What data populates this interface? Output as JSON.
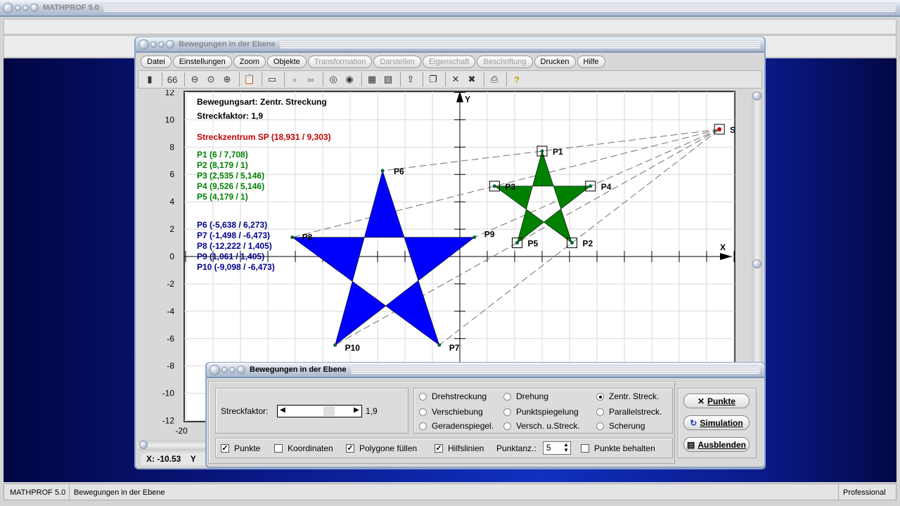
{
  "app": {
    "title": "MATHPROF 5.0"
  },
  "window": {
    "title": "Bewegungen in der Ebene",
    "menu": [
      {
        "label": "Datei",
        "enabled": true
      },
      {
        "label": "Einstellungen",
        "enabled": true
      },
      {
        "label": "Zoom",
        "enabled": true
      },
      {
        "label": "Objekte",
        "enabled": true
      },
      {
        "label": "Transformation",
        "enabled": false
      },
      {
        "label": "Darstellen",
        "enabled": false
      },
      {
        "label": "Eigenschaft",
        "enabled": false
      },
      {
        "label": "Beschriftung",
        "enabled": false
      },
      {
        "label": "Drucken",
        "enabled": true
      },
      {
        "label": "Hilfe",
        "enabled": true
      }
    ],
    "toolbar": [
      "window-icon",
      "glasses-icon",
      "zoom-out-icon",
      "zoom-reset-icon",
      "zoom-in-icon",
      "clipboard-icon",
      "layout-icon",
      "single-point-icon",
      "double-point-icon",
      "circle-icon",
      "circle-at-icon",
      "table-icon",
      "image-icon",
      "export-icon",
      "copy-icon",
      "delete-icon",
      "delete-all-icon",
      "print-icon",
      "help-icon"
    ]
  },
  "plot": {
    "info": {
      "mode": "Bewegungsart: Zentr. Streckung",
      "factor": "Streckfaktor: 1,9",
      "center": "Streckzentrum SP (18,931 / 9,303)"
    },
    "green_list": [
      "P1 (6 / 7,708)",
      "P2 (8,179 / 1)",
      "P3 (2,535 / 5,146)",
      "P4 (9,526 / 5,146)",
      "P5 (4,179 / 1)"
    ],
    "blue_list": [
      "P6 (-5,638 / 6,273)",
      "P7 (-1,498 / -6,473)",
      "P8 (-12,222 / 1,405)",
      "P9 (1,061 / 1,405)",
      "P10 (-9,098 / -6,473)"
    ],
    "y_ticks": [
      "12",
      "10",
      "8",
      "6",
      "4",
      "2",
      "0",
      "-2",
      "-4",
      "-6",
      "-8",
      "-10",
      "-12"
    ],
    "x_tick_label": "-20",
    "x_axis_label": "X",
    "y_axis_label": "Y",
    "colors": {
      "original": "#008000",
      "image": "#0000ff",
      "center": "#c00000",
      "blue_text": "#00008b",
      "red_text": "#c00000"
    },
    "center_label": "S",
    "original": [
      {
        "name": "P1",
        "x": 6,
        "y": 7.708
      },
      {
        "name": "P2",
        "x": 8.179,
        "y": 1
      },
      {
        "name": "P3",
        "x": 2.535,
        "y": 5.146
      },
      {
        "name": "P4",
        "x": 9.526,
        "y": 5.146
      },
      {
        "name": "P5",
        "x": 4.179,
        "y": 1
      }
    ],
    "image": [
      {
        "name": "P6",
        "x": -5.638,
        "y": 6.273
      },
      {
        "name": "P7",
        "x": -1.498,
        "y": -6.473
      },
      {
        "name": "P8",
        "x": -12.222,
        "y": 1.405
      },
      {
        "name": "P9",
        "x": 1.061,
        "y": 1.405
      },
      {
        "name": "P10",
        "x": -9.098,
        "y": -6.473
      }
    ],
    "sp": {
      "x": 18.931,
      "y": 9.303
    }
  },
  "coords": {
    "x": "X: -10.53",
    "y": "Y"
  },
  "dialog": {
    "title": "Bewegungen in der Ebene",
    "factor_label": "Streckfaktor:",
    "factor_value": "1,9",
    "radios": [
      {
        "label": "Drehstreckung",
        "checked": false
      },
      {
        "label": "Drehung",
        "checked": false
      },
      {
        "label": "Zentr. Streck.",
        "checked": true
      },
      {
        "label": "Verschiebung",
        "checked": false
      },
      {
        "label": "Punktspiegelung",
        "checked": false
      },
      {
        "label": "Parallelstreck.",
        "checked": false
      },
      {
        "label": "Geradenspiegel.",
        "checked": false
      },
      {
        "label": "Versch. u.Streck.",
        "checked": false
      },
      {
        "label": "Scherung",
        "checked": false
      }
    ],
    "checks": {
      "punkte": {
        "label": "Punkte",
        "checked": true
      },
      "koordinaten": {
        "label": "Koordinaten",
        "checked": false
      },
      "fuellen": {
        "label": "Polygone füllen",
        "checked": true
      },
      "hilfslinien": {
        "label": "Hilfslinien",
        "checked": true
      },
      "behalten": {
        "label": "Punkte behalten",
        "checked": false
      }
    },
    "punktanz_label": "Punktanz.:",
    "punktanz_value": "5",
    "buttons": {
      "punkte": "Punkte",
      "simulation": "Simulation",
      "ausblenden": "Ausblenden"
    }
  },
  "status": {
    "app": "MATHPROF 5.0",
    "module": "Bewegungen in der Ebene",
    "edition": "Professional"
  }
}
